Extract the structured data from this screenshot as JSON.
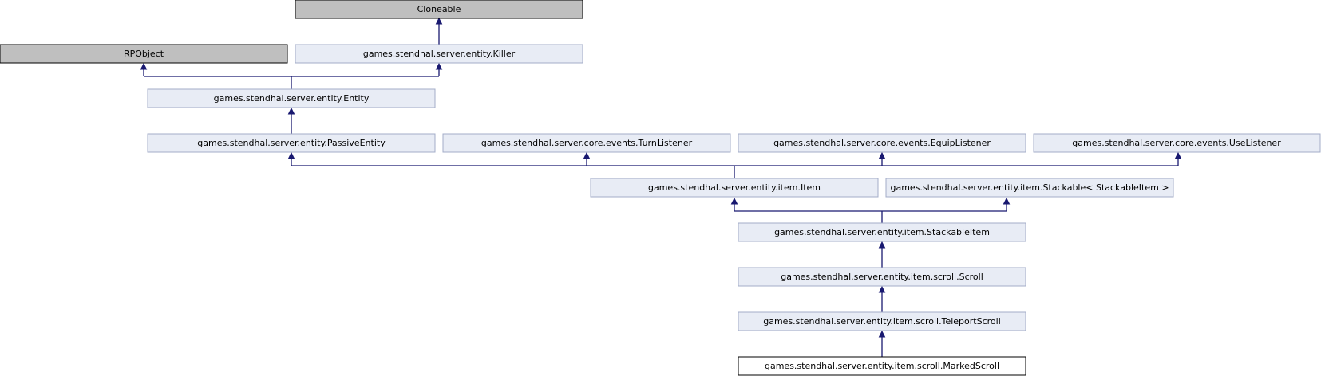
{
  "colors": {
    "external_fill": "#bfbfbf",
    "external_stroke": "#000000",
    "class_fill": "#e8ecf5",
    "class_stroke": "#a3acc8",
    "focus_fill": "#ffffff",
    "focus_stroke": "#000000",
    "edge": "#191970"
  },
  "nodes": {
    "cloneable": "Cloneable",
    "rpobject": "RPObject",
    "killer": "games.stendhal.server.entity.Killer",
    "entity": "games.stendhal.server.entity.Entity",
    "passive_entity": "games.stendhal.server.entity.PassiveEntity",
    "turn_listener": "games.stendhal.server.core.events.TurnListener",
    "equip_listener": "games.stendhal.server.core.events.EquipListener",
    "use_listener": "games.stendhal.server.core.events.UseListener",
    "item": "games.stendhal.server.entity.item.Item",
    "stackable": "games.stendhal.server.entity.item.Stackable< StackableItem >",
    "stackable_item": "games.stendhal.server.entity.item.StackableItem",
    "scroll": "games.stendhal.server.entity.item.scroll.Scroll",
    "teleport_scroll": "games.stendhal.server.entity.item.scroll.TeleportScroll",
    "marked_scroll": "games.stendhal.server.entity.item.scroll.MarkedScroll"
  }
}
